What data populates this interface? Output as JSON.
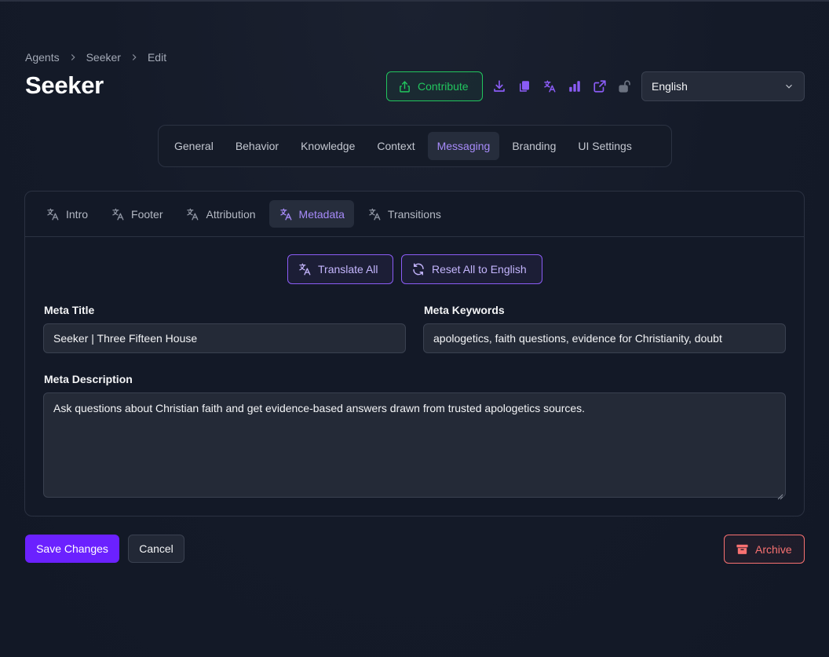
{
  "breadcrumb": {
    "items": [
      "Agents",
      "Seeker",
      "Edit"
    ]
  },
  "page": {
    "title": "Seeker"
  },
  "header": {
    "contribute_label": "Contribute",
    "icons": [
      "download-icon",
      "copy-icon",
      "translate-icon",
      "chart-icon",
      "external-link-icon",
      "unlock-icon"
    ],
    "language": "English"
  },
  "top_tabs": [
    "General",
    "Behavior",
    "Knowledge",
    "Context",
    "Messaging",
    "Branding",
    "UI Settings"
  ],
  "top_tabs_active": "Messaging",
  "sub_tabs": [
    "Intro",
    "Footer",
    "Attribution",
    "Metadata",
    "Transitions"
  ],
  "sub_tabs_active": "Metadata",
  "actions": {
    "translate_all": "Translate All",
    "reset_all": "Reset All to English"
  },
  "fields": {
    "meta_title_label": "Meta Title",
    "meta_title_value": "Seeker | Three Fifteen House",
    "meta_keywords_label": "Meta Keywords",
    "meta_keywords_value": "apologetics, faith questions, evidence for Christianity, doubt",
    "meta_description_label": "Meta Description",
    "meta_description_value": "Ask questions about Christian faith and get evidence-based answers drawn from trusted apologetics sources."
  },
  "footer": {
    "save_label": "Save Changes",
    "cancel_label": "Cancel",
    "archive_label": "Archive"
  },
  "colors": {
    "accent": "#a78bfa",
    "primary": "#6b21ff",
    "success": "#22c55e",
    "danger": "#f87171"
  }
}
